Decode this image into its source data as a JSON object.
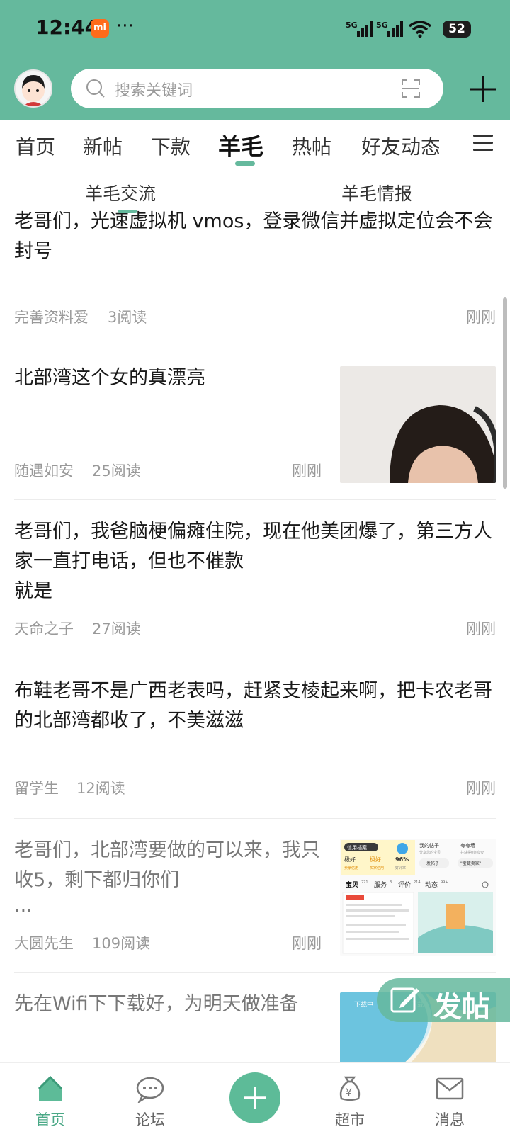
{
  "status_bar": {
    "time": "12:44",
    "mi_badge": "mi",
    "dots": "···",
    "net1": "5G",
    "net2": "5G",
    "battery": "52"
  },
  "search": {
    "placeholder": "搜索关键词"
  },
  "tabs": [
    {
      "label": "首页"
    },
    {
      "label": "新帖"
    },
    {
      "label": "下款"
    },
    {
      "label": "羊毛",
      "active": true
    },
    {
      "label": "热帖"
    },
    {
      "label": "好友动态"
    }
  ],
  "subtabs": [
    {
      "label": "羊毛交流",
      "active": true
    },
    {
      "label": "羊毛情报"
    }
  ],
  "posts": [
    {
      "title": "老哥们，光速虚拟机 vmos，登录微信并虚拟定位会不会封号",
      "author": "完善资料爱",
      "reads": "3阅读",
      "time": "刚刚"
    },
    {
      "title": "北部湾这个女的真漂亮",
      "author": "随遇如安",
      "reads": "25阅读",
      "time": "刚刚",
      "has_image": true
    },
    {
      "title": "老哥们，我爸脑梗偏瘫住院，现在他美团爆了，第三方人家一直打电话，但也不催款",
      "title2": "就是",
      "author": "天命之子",
      "reads": "27阅读",
      "time": "刚刚"
    },
    {
      "title": "布鞋老哥不是广西老表吗，赶紧支棱起来啊，把卡农老哥的北部湾都收了，不美滋滋",
      "author": "留学生",
      "reads": "12阅读",
      "time": "刚刚"
    },
    {
      "title": "老哥们，北部湾要做的可以来，我只收5，剩下都归你们",
      "title2": "...",
      "author": "大圆先生",
      "reads": "109阅读",
      "time": "刚刚",
      "has_image": true
    },
    {
      "title": "先在Wifi下下载好，为明天做准备",
      "has_image": true
    }
  ],
  "thumb2": {
    "header": "信用档案",
    "r1": "极好",
    "r2": "极好",
    "r3": "96%",
    "r1s": "卖家信用",
    "r2s": "买家信用",
    "r3s": "好评率",
    "mine": "我的帖子",
    "mine_sub": "分享您的宝贝",
    "post_btn": "发帖子",
    "boast": "夸夸墙",
    "boast_sub": "共获得0条夸夸",
    "boast_btn": "\"宝藏卖家\"",
    "t1": "宝贝",
    "t1n": "271",
    "t2": "服务",
    "t2n": "3",
    "t3": "评价",
    "t3n": "214",
    "t4": "动态",
    "t4n": "99+"
  },
  "thumb3": {
    "l1": "下载中",
    "l2": "下载"
  },
  "fab": {
    "label": "发帖"
  },
  "bottom_nav": [
    {
      "label": "首页",
      "active": true
    },
    {
      "label": "论坛"
    },
    {
      "label": ""
    },
    {
      "label": "超市"
    },
    {
      "label": "消息"
    }
  ],
  "colors": {
    "accent": "#65b99d"
  }
}
